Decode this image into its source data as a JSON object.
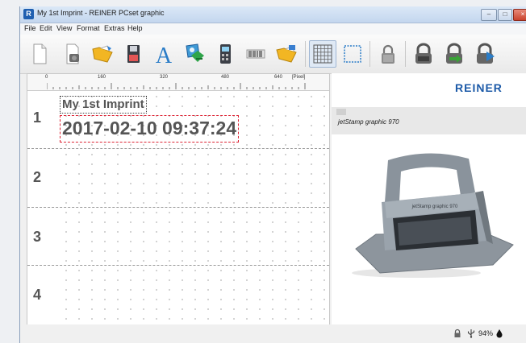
{
  "window": {
    "title": "My 1st Imprint - REINER PCset graphic",
    "app_icon_glyph": "R",
    "buttons": {
      "minimize": "–",
      "maximize": "□",
      "close": "×"
    }
  },
  "menu": [
    "File",
    "Edit",
    "View",
    "Format",
    "Extras",
    "Help"
  ],
  "toolbar": [
    "new-document-icon",
    "print-icon",
    "open-folder-icon",
    "save-disk-icon",
    "text-tool-icon",
    "image-tool-icon",
    "counter-tool-icon",
    "barcode-tool-icon",
    "import-folder-icon",
    "grid-toggle-icon",
    "frame-toggle-icon",
    "lock-icon",
    "stamp-icon",
    "stamp-transfer-icon",
    "stamp-export-icon"
  ],
  "ruler": {
    "labels": [
      "0",
      "160",
      "320",
      "480",
      "640",
      "[Pixel]"
    ]
  },
  "editor": {
    "rows": [
      "1",
      "2",
      "3",
      "4"
    ],
    "line1": "My 1st Imprint",
    "line2": "2017-02-10 09:37:24"
  },
  "preview": {
    "brand": "REINER",
    "product": "jetStamp graphic 970",
    "device_label": "jetStamp graphic 970"
  },
  "status": {
    "ink_percent": "94%"
  },
  "colors": {
    "brand_blue": "#1c5aa8",
    "selection_red": "#dd2233",
    "accent_green": "#3aa337"
  }
}
